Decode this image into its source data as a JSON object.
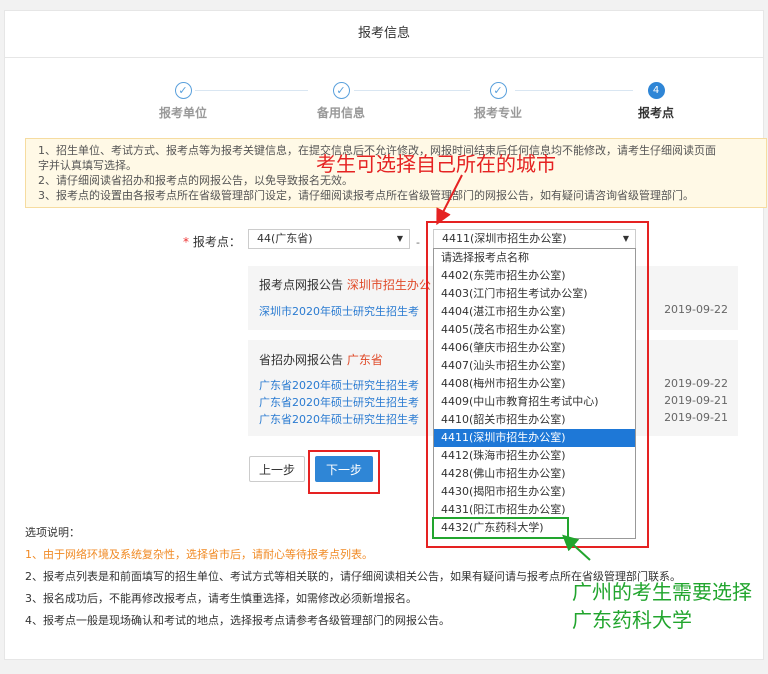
{
  "header": {
    "title": "报考信息"
  },
  "steps": [
    {
      "label": "报考单位",
      "icon": "check-icon",
      "mark": "✓",
      "active": false
    },
    {
      "label": "备用信息",
      "icon": "check-icon",
      "mark": "✓",
      "active": false
    },
    {
      "label": "报考专业",
      "icon": "check-icon",
      "mark": "✓",
      "active": false
    },
    {
      "label": "报考点",
      "icon": "step-number",
      "mark": "4",
      "active": true
    }
  ],
  "notice": {
    "lines": [
      "1、招生单位、考试方式、报考点等为报考关键信息，在提交信息后不允许修改，网报时间结束后任何信息均不能修改，请考生仔细阅读页面",
      "字并认真填写选择。",
      "2、请仔细阅读省招办和报考点的网报公告，以免导致报名无效。",
      "3、报考点的设置由各报考点所在省级管理部门设定，请仔细阅读报考点所在省级管理部门的网报公告，如有疑问请咨询省级管理部门。"
    ]
  },
  "form": {
    "required_mark": "*",
    "label": "报考点：",
    "province_select": "44(广东省)",
    "dash": "-",
    "site_select": "4411(深圳市招生办公室)"
  },
  "dropdown": {
    "options": [
      "请选择报考点名称",
      "4402(东莞市招生办公室)",
      "4403(江门市招生考试办公室)",
      "4404(湛江市招生办公室)",
      "4405(茂名市招生办公室)",
      "4406(肇庆市招生办公室)",
      "4407(汕头市招生办公室)",
      "4408(梅州市招生办公室)",
      "4409(中山市教育招生考试中心)",
      "4410(韶关市招生办公室)",
      "4411(深圳市招生办公室)",
      "4412(珠海市招生办公室)",
      "4428(佛山市招生办公室)",
      "4430(揭阳市招生办公室)",
      "4431(阳江市招生办公室)",
      "4432(广东药科大学)"
    ],
    "selected_index": 10
  },
  "site_announcement": {
    "title": "报考点网报公告",
    "source": "深圳市招生办公",
    "items": [
      {
        "text": "深圳市2020年硕士研究生招生考",
        "date": "2019-09-22"
      }
    ]
  },
  "province_announcement": {
    "title": "省招办网报公告",
    "source": "广东省",
    "items": [
      {
        "text": "广东省2020年硕士研究生招生考",
        "date": "2019-09-22"
      },
      {
        "text": "广东省2020年硕士研究生招生考",
        "date": "2019-09-21"
      },
      {
        "text": "广东省2020年硕士研究生招生考",
        "date": "2019-09-21"
      }
    ]
  },
  "buttons": {
    "prev": "上一步",
    "next": "下一步"
  },
  "notes": {
    "title": "选项说明：",
    "items": [
      "1、由于网络环境及系统复杂性，选择省市后，请耐心等待报考点列表。",
      "2、报考点列表是和前面填写的招生单位、考试方式等相关联的，请仔细阅读相关公告，如果有疑问请与报考点所在省级管理部门联系。",
      "3、报名成功后，不能再修改报考点，请考生慎重选择，如需修改必须新增报名。",
      "4、报考点一般是现场确认和考试的地点，选择报考点请参考各级管理部门的网报公告。"
    ]
  },
  "annotations": {
    "red_text": "考生可选择自己所在的城市",
    "green_text": "广州的考生需要选择广东药科大学",
    "red_color": "#e52222",
    "green_color": "#22a52e"
  },
  "colors": {
    "primary": "#2f86d6",
    "link": "#2a7bd1",
    "warning": "#f08a24"
  }
}
